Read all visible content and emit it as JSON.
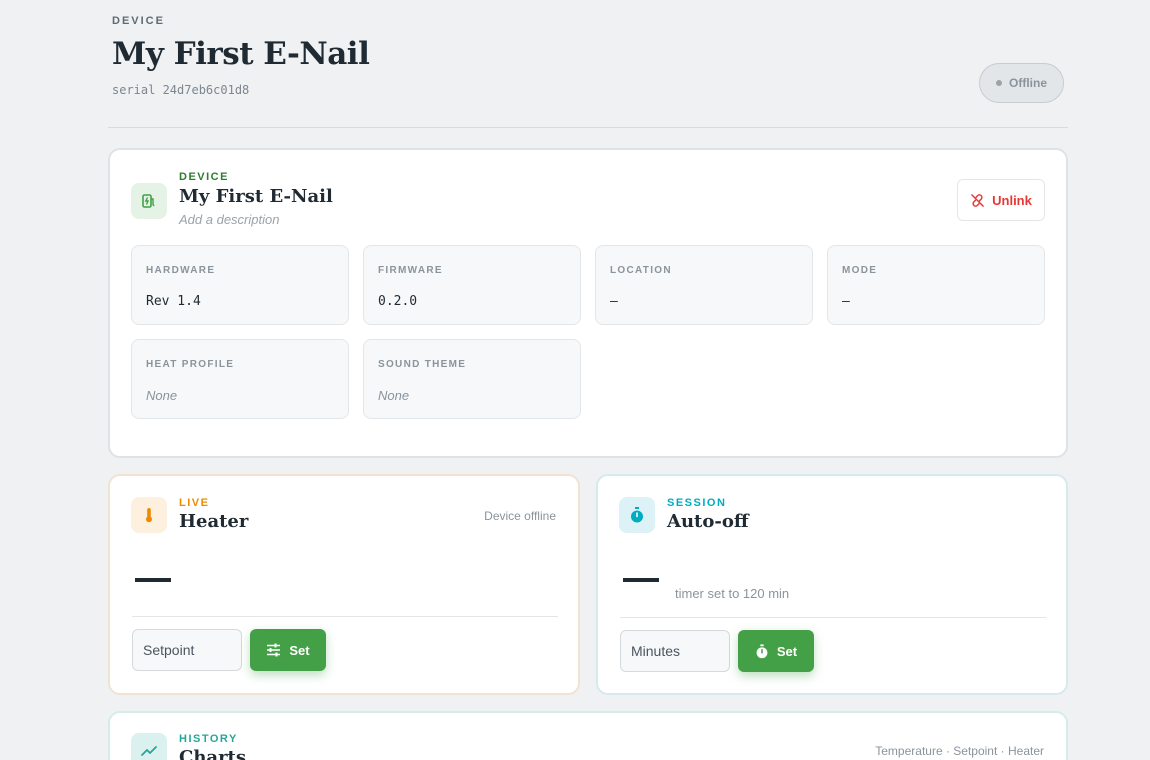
{
  "header": {
    "eyebrow": "DEVICE",
    "title": "My First E-Nail",
    "serial": "serial 24d7eb6c01d8",
    "status": "Offline"
  },
  "device_card": {
    "kicker": "DEVICE",
    "name": "My First E-Nail",
    "description_placeholder": "Add a description",
    "unlink_label": "Unlink",
    "specs": [
      {
        "label": "HARDWARE",
        "value": "Rev 1.4"
      },
      {
        "label": "FIRMWARE",
        "value": "0.2.0"
      },
      {
        "label": "LOCATION",
        "value": "—"
      },
      {
        "label": "MODE",
        "value": "—"
      },
      {
        "label": "HEAT PROFILE",
        "value": "None"
      },
      {
        "label": "SOUND THEME",
        "value": "None"
      }
    ]
  },
  "heater_card": {
    "kicker": "LIVE",
    "title": "Heater",
    "status_note": "Device offline",
    "setpoint_placeholder": "Setpoint",
    "set_label": "Set"
  },
  "session_card": {
    "kicker": "SESSION",
    "title": "Auto-off",
    "timer_note": "timer set to 120 min",
    "minutes_placeholder": "Minutes",
    "set_label": "Set"
  },
  "history_card": {
    "kicker": "HISTORY",
    "title": "Charts",
    "legend": "Temperature · Setpoint · Heater"
  },
  "colors": {
    "device_accent": "#2e7d32",
    "live_accent": "#ef8a00",
    "session_accent": "#00acc1",
    "history_accent": "#26a69a",
    "primary_button": "#43a047",
    "danger": "#e53935"
  },
  "icons": {
    "device": "ev-plug-icon",
    "live": "thermometer-icon",
    "session": "stopwatch-icon",
    "history": "trend-line-icon",
    "unlink": "broken-link-icon",
    "setpoint": "sliders-icon",
    "timer": "stopwatch-icon"
  }
}
